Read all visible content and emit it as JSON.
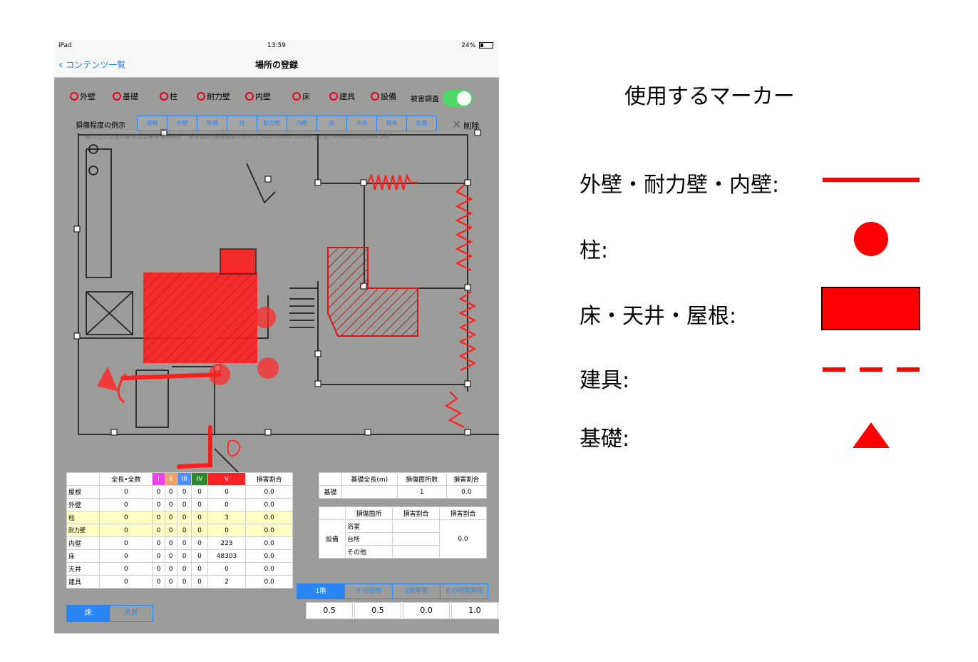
{
  "status_bar": {
    "device": "iPad",
    "time": "13:59",
    "battery": "24%"
  },
  "nav": {
    "back_label": "コンテンツ一覧",
    "title": "場所の登録"
  },
  "categories": [
    "外壁",
    "基礎",
    "柱",
    "耐力壁",
    "内壁",
    "床",
    "建具",
    "設備"
  ],
  "toggle_label": "被害調査",
  "seg_label": "損傷程度の例示",
  "seg_items": [
    "屋根",
    "外壁",
    "基礎",
    "柱",
    "耐力壁",
    "内壁",
    "床",
    "天井",
    "建具",
    "設備"
  ],
  "delete_label": "削除",
  "ref_note": "被災した住家の被害認定基準運用指針（参考資料(損傷程度の例示)）http://www.bousai.go.jp/taisaku/pdf/jirei4.pdf",
  "main_table": {
    "headers": [
      "",
      "全長•全数",
      "I",
      "II",
      "III",
      "IV",
      "V",
      "損害割合"
    ],
    "header_colors": [
      "#ffffff",
      "#ffffff",
      "#ee44ee",
      "#f0a060",
      "#4f8cff",
      "#2a8a2a",
      "#ff2222",
      "#ffffff"
    ],
    "rows": [
      [
        "屋根",
        "0",
        "0",
        "0",
        "0",
        "0",
        "0",
        "0.0"
      ],
      [
        "外壁",
        "0",
        "0",
        "0",
        "0",
        "0",
        "0",
        "0.0"
      ],
      [
        "柱",
        "0",
        "0",
        "0",
        "0",
        "0",
        "3",
        "0.0"
      ],
      [
        "耐力壁",
        "0",
        "0",
        "0",
        "0",
        "0",
        "0",
        "0.0"
      ],
      [
        "内壁",
        "0",
        "0",
        "0",
        "0",
        "0",
        "223",
        "0.0"
      ],
      [
        "床",
        "0",
        "0",
        "0",
        "0",
        "0",
        "48303",
        "0.0"
      ],
      [
        "天井",
        "0",
        "0",
        "0",
        "0",
        "0",
        "0",
        "0.0"
      ],
      [
        "建具",
        "0",
        "0",
        "0",
        "0",
        "0",
        "2",
        "0.0"
      ]
    ]
  },
  "foundation_table": {
    "headers": [
      "",
      "基礎全長(m)",
      "損傷箇所数",
      "損害割合"
    ],
    "row": [
      "基礎",
      "",
      "1",
      "0.0"
    ]
  },
  "equipment_table": {
    "headers": [
      "",
      "損傷箇所",
      "損害割合",
      "損害割合"
    ],
    "label": "設備",
    "items": [
      "浴室",
      "台所",
      "その他"
    ],
    "ratio": "0.0"
  },
  "level_seg": [
    "1階",
    "その他階",
    "1階屋根",
    "その他階屋根"
  ],
  "level_values": [
    "0.5",
    "0.5",
    "0.0",
    "1.0"
  ],
  "floor_ceiling": [
    "床",
    "天井"
  ],
  "legend": {
    "title": "使用するマーカー",
    "items": [
      "外壁・耐力壁・内壁:",
      "柱:",
      "床・天井・屋根:",
      "建具:",
      "基礎:"
    ]
  },
  "colors": {
    "marker_red": "#ff0000",
    "accent_blue": "#2b86f5",
    "toggle_green": "#4cd964",
    "highlight_yellow": "#ffffc4"
  }
}
